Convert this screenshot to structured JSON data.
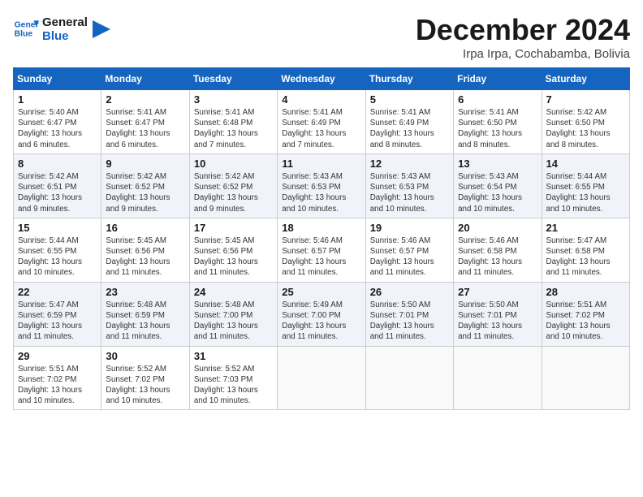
{
  "header": {
    "logo_line1": "General",
    "logo_line2": "Blue",
    "month_title": "December 2024",
    "subtitle": "Irpa Irpa, Cochabamba, Bolivia"
  },
  "weekdays": [
    "Sunday",
    "Monday",
    "Tuesday",
    "Wednesday",
    "Thursday",
    "Friday",
    "Saturday"
  ],
  "weeks": [
    [
      {
        "day": "1",
        "sunrise": "5:40 AM",
        "sunset": "6:47 PM",
        "daylight": "13 hours and 6 minutes."
      },
      {
        "day": "2",
        "sunrise": "5:41 AM",
        "sunset": "6:47 PM",
        "daylight": "13 hours and 6 minutes."
      },
      {
        "day": "3",
        "sunrise": "5:41 AM",
        "sunset": "6:48 PM",
        "daylight": "13 hours and 7 minutes."
      },
      {
        "day": "4",
        "sunrise": "5:41 AM",
        "sunset": "6:49 PM",
        "daylight": "13 hours and 7 minutes."
      },
      {
        "day": "5",
        "sunrise": "5:41 AM",
        "sunset": "6:49 PM",
        "daylight": "13 hours and 8 minutes."
      },
      {
        "day": "6",
        "sunrise": "5:41 AM",
        "sunset": "6:50 PM",
        "daylight": "13 hours and 8 minutes."
      },
      {
        "day": "7",
        "sunrise": "5:42 AM",
        "sunset": "6:50 PM",
        "daylight": "13 hours and 8 minutes."
      }
    ],
    [
      {
        "day": "8",
        "sunrise": "5:42 AM",
        "sunset": "6:51 PM",
        "daylight": "13 hours and 9 minutes."
      },
      {
        "day": "9",
        "sunrise": "5:42 AM",
        "sunset": "6:52 PM",
        "daylight": "13 hours and 9 minutes."
      },
      {
        "day": "10",
        "sunrise": "5:42 AM",
        "sunset": "6:52 PM",
        "daylight": "13 hours and 9 minutes."
      },
      {
        "day": "11",
        "sunrise": "5:43 AM",
        "sunset": "6:53 PM",
        "daylight": "13 hours and 10 minutes."
      },
      {
        "day": "12",
        "sunrise": "5:43 AM",
        "sunset": "6:53 PM",
        "daylight": "13 hours and 10 minutes."
      },
      {
        "day": "13",
        "sunrise": "5:43 AM",
        "sunset": "6:54 PM",
        "daylight": "13 hours and 10 minutes."
      },
      {
        "day": "14",
        "sunrise": "5:44 AM",
        "sunset": "6:55 PM",
        "daylight": "13 hours and 10 minutes."
      }
    ],
    [
      {
        "day": "15",
        "sunrise": "5:44 AM",
        "sunset": "6:55 PM",
        "daylight": "13 hours and 10 minutes."
      },
      {
        "day": "16",
        "sunrise": "5:45 AM",
        "sunset": "6:56 PM",
        "daylight": "13 hours and 11 minutes."
      },
      {
        "day": "17",
        "sunrise": "5:45 AM",
        "sunset": "6:56 PM",
        "daylight": "13 hours and 11 minutes."
      },
      {
        "day": "18",
        "sunrise": "5:46 AM",
        "sunset": "6:57 PM",
        "daylight": "13 hours and 11 minutes."
      },
      {
        "day": "19",
        "sunrise": "5:46 AM",
        "sunset": "6:57 PM",
        "daylight": "13 hours and 11 minutes."
      },
      {
        "day": "20",
        "sunrise": "5:46 AM",
        "sunset": "6:58 PM",
        "daylight": "13 hours and 11 minutes."
      },
      {
        "day": "21",
        "sunrise": "5:47 AM",
        "sunset": "6:58 PM",
        "daylight": "13 hours and 11 minutes."
      }
    ],
    [
      {
        "day": "22",
        "sunrise": "5:47 AM",
        "sunset": "6:59 PM",
        "daylight": "13 hours and 11 minutes."
      },
      {
        "day": "23",
        "sunrise": "5:48 AM",
        "sunset": "6:59 PM",
        "daylight": "13 hours and 11 minutes."
      },
      {
        "day": "24",
        "sunrise": "5:48 AM",
        "sunset": "7:00 PM",
        "daylight": "13 hours and 11 minutes."
      },
      {
        "day": "25",
        "sunrise": "5:49 AM",
        "sunset": "7:00 PM",
        "daylight": "13 hours and 11 minutes."
      },
      {
        "day": "26",
        "sunrise": "5:50 AM",
        "sunset": "7:01 PM",
        "daylight": "13 hours and 11 minutes."
      },
      {
        "day": "27",
        "sunrise": "5:50 AM",
        "sunset": "7:01 PM",
        "daylight": "13 hours and 11 minutes."
      },
      {
        "day": "28",
        "sunrise": "5:51 AM",
        "sunset": "7:02 PM",
        "daylight": "13 hours and 10 minutes."
      }
    ],
    [
      {
        "day": "29",
        "sunrise": "5:51 AM",
        "sunset": "7:02 PM",
        "daylight": "13 hours and 10 minutes."
      },
      {
        "day": "30",
        "sunrise": "5:52 AM",
        "sunset": "7:02 PM",
        "daylight": "13 hours and 10 minutes."
      },
      {
        "day": "31",
        "sunrise": "5:52 AM",
        "sunset": "7:03 PM",
        "daylight": "13 hours and 10 minutes."
      },
      null,
      null,
      null,
      null
    ]
  ],
  "labels": {
    "sunrise": "Sunrise:",
    "sunset": "Sunset:",
    "daylight": "Daylight:"
  }
}
